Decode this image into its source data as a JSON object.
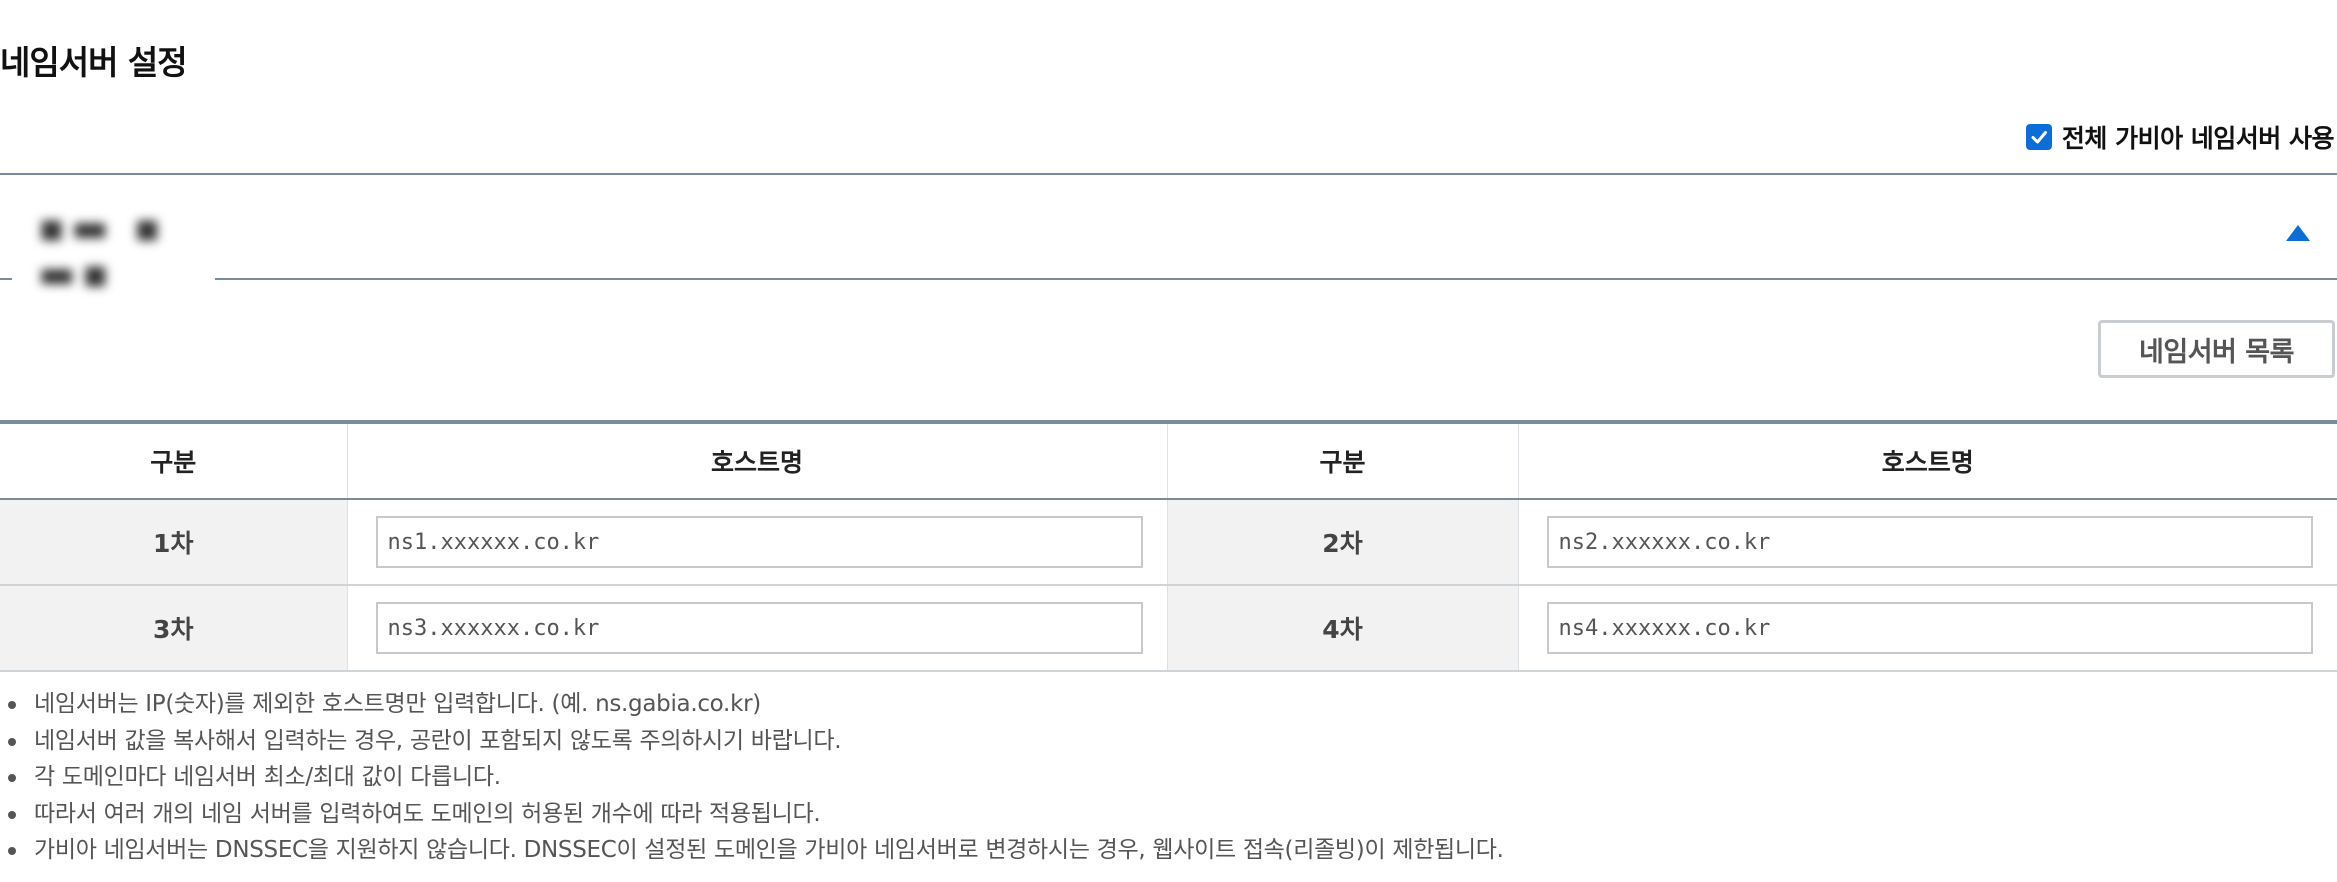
{
  "page": {
    "title": "네임서버 설정"
  },
  "options": {
    "use_all_gabia_ns_label": "전체 가비아 네임서버 사용",
    "use_all_gabia_ns_checked": true
  },
  "domain": {
    "name": "▪▬ ▪ ▬▪"
  },
  "actions": {
    "ns_list_label": "네임서버 목록"
  },
  "table": {
    "headers": [
      "구분",
      "호스트명",
      "구분",
      "호스트명"
    ],
    "rows": [
      {
        "left_label": "1차",
        "left_host": "ns1.xxxxxx.co.kr",
        "right_label": "2차",
        "right_host": "ns2.xxxxxx.co.kr"
      },
      {
        "left_label": "3차",
        "left_host": "ns3.xxxxxx.co.kr",
        "right_label": "4차",
        "right_host": "ns4.xxxxxx.co.kr"
      }
    ]
  },
  "notes": [
    "네임서버는 IP(숫자)를 제외한 호스트명만 입력합니다. (예. ns.gabia.co.kr)",
    "네임서버 값을 복사해서 입력하는 경우, 공란이 포함되지 않도록 주의하시기 바랍니다.",
    "각 도메인마다 네임서버 최소/최대 값이 다릅니다.",
    "따라서 여러 개의 네임 서버를 입력하여도 도메인의 허용된 개수에 따라 적용됩니다.",
    "가비아 네임서버는 DNSSEC을 지원하지 않습니다. DNSSEC이 설정된 도메인을 가비아 네임서버로 변경하시는 경우, 웹사이트 접속(리졸빙)이 제한됩니다."
  ],
  "colors": {
    "accent": "#0b6ed8",
    "divider": "#7a8b99",
    "label_bg": "#f2f2f2"
  },
  "icons": {
    "checkbox": "check-icon",
    "collapse": "triangle-up-icon"
  }
}
